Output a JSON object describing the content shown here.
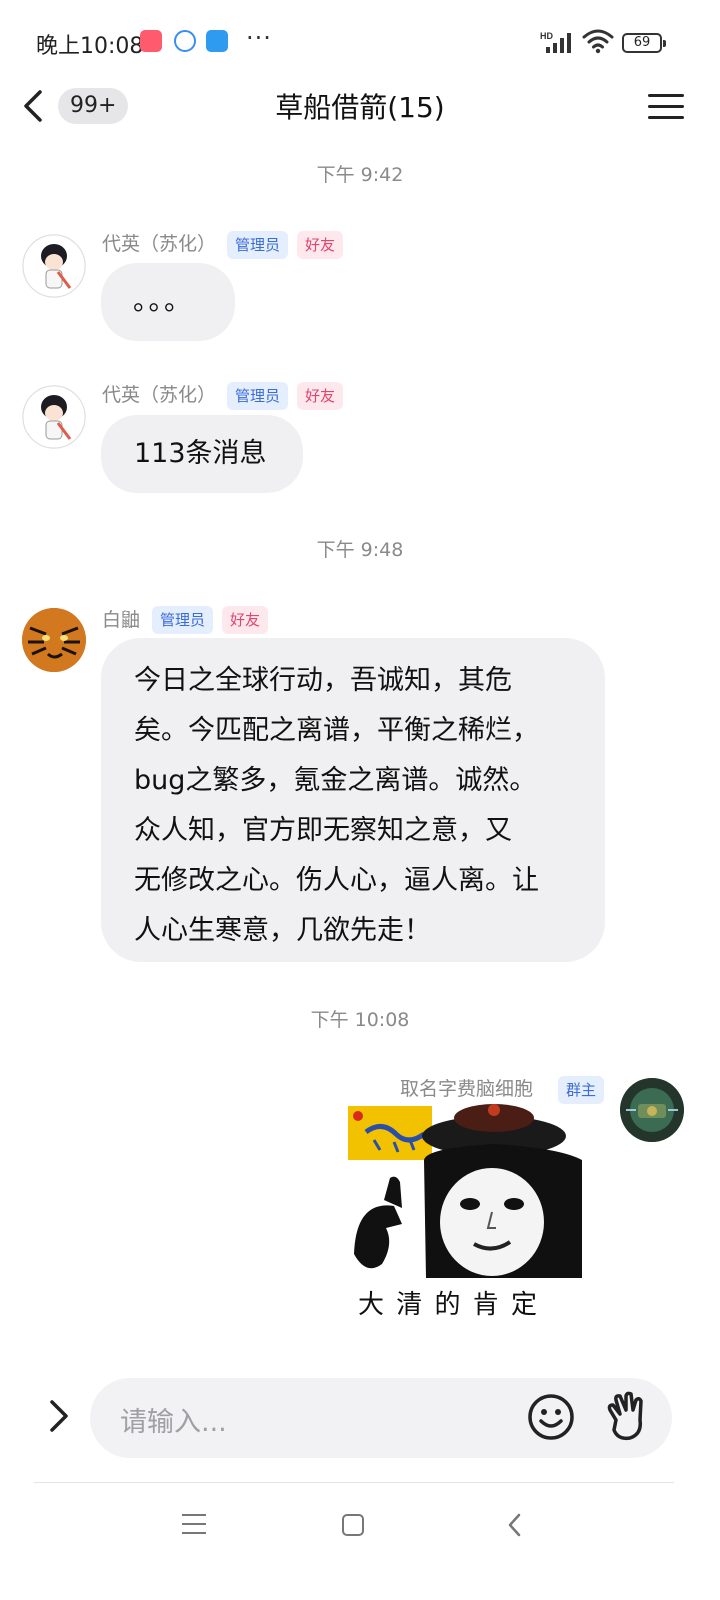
{
  "status_bar": {
    "time": "晚上10:08",
    "more": "···",
    "network": "HD",
    "battery": "69"
  },
  "header": {
    "unread_count": "99+",
    "title": "草船借箭(15)"
  },
  "chat": {
    "time_labels": [
      "下午 9:42",
      "下午 9:48",
      "下午 10:08"
    ],
    "messages": [
      {
        "sender": "代英（苏化）",
        "tags": [
          "管理员",
          "好友"
        ],
        "text": "。。。"
      },
      {
        "sender": "代英（苏化）",
        "tags": [
          "管理员",
          "好友"
        ],
        "text": "113条消息"
      },
      {
        "sender": "白鼬",
        "tags": [
          "管理员",
          "好友"
        ],
        "lines": [
          "今日之全球行动，吾诚知，其危",
          "矣。今匹配之离谱，平衡之稀烂，",
          "bug之繁多，氪金之离谱。诚然。",
          "众人知，官方即无察知之意，又",
          "无修改之心。伤人心，逼人离。让",
          "人心生寒意，几欲先走！"
        ]
      },
      {
        "sender": "取名字费脑细胞",
        "tags": [
          "群主"
        ],
        "sticker_caption": "大 清 的 肯 定"
      }
    ]
  },
  "input": {
    "placeholder": "请输入..."
  },
  "colors": {
    "bubble": "#f0f0f2",
    "admin_tag": "#3b6cd8",
    "friend_tag": "#e2456c"
  }
}
